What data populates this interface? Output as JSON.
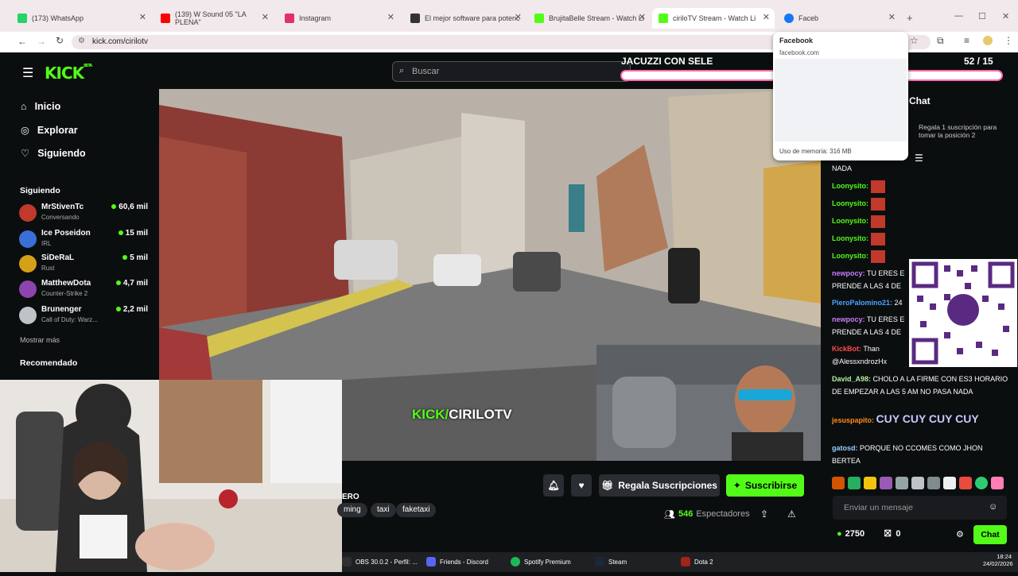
{
  "tabs": [
    {
      "label": "(173) WhatsApp",
      "color": "#25d366"
    },
    {
      "label": "(139) W Sound 05 \"LA PLENA\"",
      "color": "#ff0000"
    },
    {
      "label": "Instagram",
      "color": "#e1306c"
    },
    {
      "label": "El mejor software para potenc",
      "color": "#333333"
    },
    {
      "label": "BrujitaBelle Stream - Watch Li",
      "color": "#53fc18"
    },
    {
      "label": "ciriloTV Stream - Watch Li",
      "color": "#53fc18"
    },
    {
      "label": "Faceb",
      "color": "#1877f2"
    }
  ],
  "url": "kick.com/cirilotv",
  "popup": {
    "title": "Facebook",
    "domain": "facebook.com",
    "memory": "Uso de memoria: 316 MB"
  },
  "header": {
    "logo": "KICK",
    "logo_badge": "BETA",
    "search_placeholder": "Buscar"
  },
  "nav": [
    {
      "label": "Inicio",
      "icon": "home-icon"
    },
    {
      "label": "Explorar",
      "icon": "compass-icon"
    },
    {
      "label": "Siguiendo",
      "icon": "heart-icon"
    }
  ],
  "following_title": "Siguiendo",
  "following": [
    {
      "name": "MrStivenTc",
      "category": "Conversando",
      "viewers": "60,6 mil",
      "color": "#c0392b"
    },
    {
      "name": "Ice Poseidon",
      "category": "IRL",
      "viewers": "15 mil",
      "color": "#3a6fd8"
    },
    {
      "name": "SiDeRaL",
      "category": "Rust",
      "viewers": "5 mil",
      "color": "#d4a017"
    },
    {
      "name": "MatthewDota",
      "category": "Counter-Strike 2",
      "viewers": "4,7 mil",
      "color": "#8e44ad"
    },
    {
      "name": "Brunenger",
      "category": "Call of Duty: Warz...",
      "viewers": "2,2 mil",
      "color": "#bdc3c7"
    }
  ],
  "show_more": "Mostrar más",
  "recommended_title": "Recomendado",
  "overlay": {
    "goal_title": "JACUZZI CON SELE",
    "goal_count": "52 / 15",
    "goal_progress": 0.98,
    "watermark_a": "KICK/",
    "watermark_b": "CIRILOTV"
  },
  "stream": {
    "title_tail": "ERO",
    "tags": [
      "ming",
      "taxi",
      "faketaxi"
    ],
    "gift_label": "Regala Suscripciones",
    "subscribe_label": "Suscribirse",
    "viewers": "546",
    "viewers_label": "Espectadores"
  },
  "chat": {
    "header": "Chat",
    "gift_hint": "Regala 1 suscripción para tomar la posición 2",
    "messages": [
      {
        "user": "",
        "text": "NADA",
        "color": "#ffffff"
      },
      {
        "user": "Loonysito:",
        "text": "",
        "color": "#53fc18"
      },
      {
        "user": "Loonysito:",
        "text": "",
        "color": "#53fc18"
      },
      {
        "user": "Loonysito:",
        "text": "",
        "color": "#53fc18"
      },
      {
        "user": "Loonysito:",
        "text": "",
        "color": "#53fc18"
      },
      {
        "user": "Loonysito:",
        "text": "",
        "color": "#53fc18"
      },
      {
        "user": "newpocy:",
        "text": "TU ERES E PRENDE A LAS 4 DE",
        "color": "#c77dff"
      },
      {
        "user": "PieroPalomino21:",
        "text": "24",
        "color": "#4da3ff"
      },
      {
        "user": "newpocy:",
        "text": "TU ERES E PRENDE A LAS 4 DE",
        "color": "#c77dff"
      },
      {
        "user": "KickBot:",
        "text": "Than @AlessxndrozHx",
        "color": "#ff4b4b"
      },
      {
        "user": "David_A98:",
        "text": "CHOLO A LA FIRME CON ES3 HORARIO DE EMPEZAR A LAS 5 AM NO PASA NADA",
        "color": "#b5f0a3"
      },
      {
        "user": "jesuspapito:",
        "text": "CUY CUY CUY CUY",
        "color": "#ff8c1a"
      },
      {
        "user": "gatosd:",
        "text": "PORQUE NO CCOMES COMO JHON BERTEA",
        "color": "#9cf"
      }
    ],
    "input_placeholder": "Enviar un mensaje",
    "points": "2750",
    "gifts": "0",
    "send_label": "Chat"
  },
  "taskbar": [
    {
      "label": "OBS 30.0.2 - Perfil: ...",
      "color": "#303030"
    },
    {
      "label": "Friends - Discord",
      "color": "#5865f2"
    },
    {
      "label": "Spotify Premium",
      "color": "#1db954"
    },
    {
      "label": "Steam",
      "color": "#1b2838"
    },
    {
      "label": "Dota 2",
      "color": "#a1231a"
    }
  ],
  "clock": {
    "time": "18:24",
    "date": "24/02/2026"
  }
}
